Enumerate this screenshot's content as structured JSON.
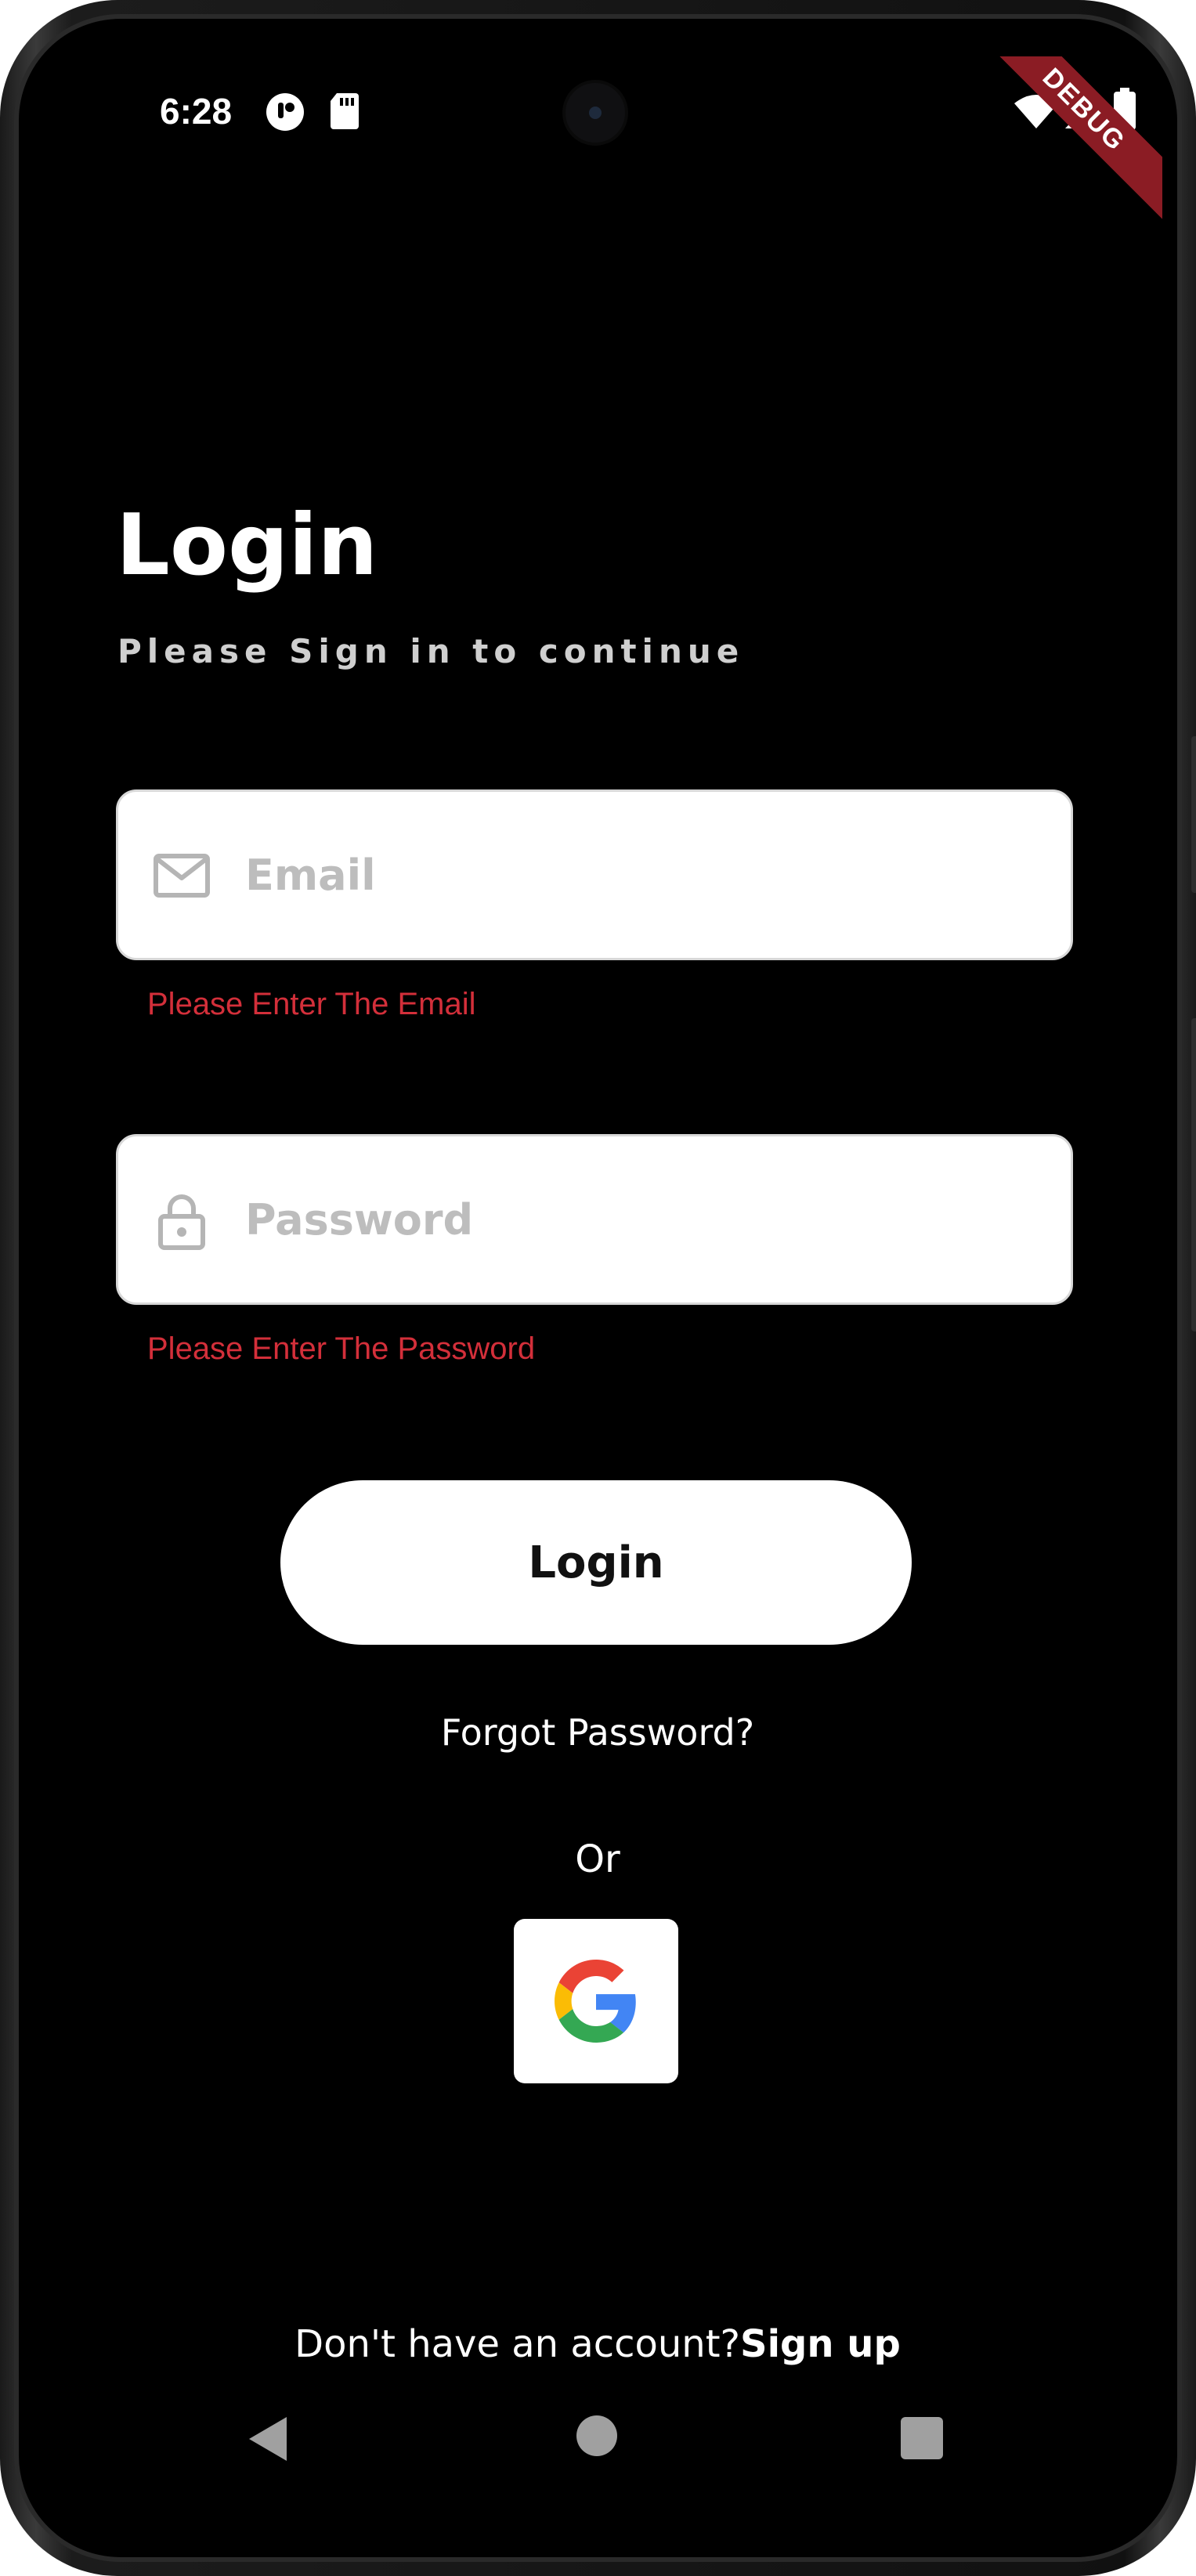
{
  "status_bar": {
    "time": "6:28",
    "left_icons": [
      "notification-app-icon",
      "sd-card-icon"
    ],
    "right_icons": [
      "wifi-icon",
      "signal-icon",
      "battery-icon"
    ],
    "debug_banner": "DEBUG"
  },
  "header": {
    "title": "Login",
    "subtitle": "Please Sign in to continue"
  },
  "form": {
    "email": {
      "icon": "mail-icon",
      "placeholder": "Email",
      "value": "",
      "error": "Please Enter The Email"
    },
    "password": {
      "icon": "lock-icon",
      "placeholder": "Password",
      "value": "",
      "error": "Please Enter The Password"
    },
    "login_button": "Login",
    "forgot_password": "Forgot Password?",
    "or_label": "Or",
    "google_icon": "google-icon"
  },
  "footer": {
    "prompt": "Don't have an account?",
    "signup_label": "Sign up"
  },
  "nav_bar": {
    "icons": [
      "back-icon",
      "home-icon",
      "recents-icon"
    ]
  },
  "colors": {
    "background": "#000000",
    "error": "#d32f3a",
    "debug_ribbon": "#8b1c24",
    "button": "#ffffff"
  }
}
